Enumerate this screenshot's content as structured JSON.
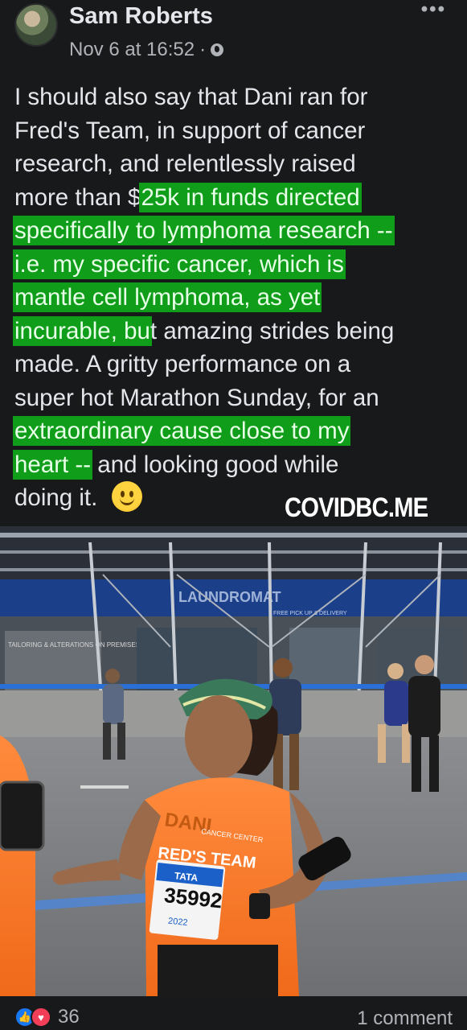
{
  "post": {
    "author": "Sam Roberts",
    "timestamp": "Nov 6 at 16:52",
    "separator": "·",
    "privacy_icon": "globe-icon",
    "more_icon": "more-options-icon",
    "more_glyph": "•••",
    "text_lines": [
      [
        {
          "t": "I should also say that Dani ran for",
          "hl": false
        }
      ],
      [
        {
          "t": "Fred's Team, in support of cancer",
          "hl": false
        }
      ],
      [
        {
          "t": "research, and relentlessly raised",
          "hl": false
        }
      ],
      [
        {
          "t": "more than $",
          "hl": false
        },
        {
          "t": "25k in funds directed",
          "hl": true
        }
      ],
      [
        {
          "t": "specifically to lymphoma research --",
          "hl": true
        }
      ],
      [
        {
          "t": "i.e. my specific cancer, which is",
          "hl": true
        }
      ],
      [
        {
          "t": "mantle cell lymphoma, as yet",
          "hl": true
        }
      ],
      [
        {
          "t": "incurable, bu",
          "hl": true
        },
        {
          "t": "t amazing strides being",
          "hl": false
        }
      ],
      [
        {
          "t": "made.  A gritty performance on a",
          "hl": false
        }
      ],
      [
        {
          "t": "super hot Marathon Sunday, for an",
          "hl": false
        }
      ],
      [
        {
          "t": "extraordinary cause close to my",
          "hl": true
        }
      ],
      [
        {
          "t": "heart --",
          "hl": true
        },
        {
          "t": " and looking good while",
          "hl": false
        }
      ],
      [
        {
          "t": "doing it.",
          "hl": false
        }
      ]
    ],
    "emoji": "slightly-smiling-face-emoji",
    "highlight_color": "#0f9d1a"
  },
  "watermark": "COVIDBC.ME",
  "photo": {
    "storefront_sign": "LAUNDROMAT",
    "shop_sign": "TAILORING & ALTERATIONS ON PREMISES",
    "awning_text": "FREE PICK UP & DELIVERY",
    "shirt_name": "DANI",
    "shirt_team": "RED'S TEAM",
    "shirt_sub": "CANCER CENTER",
    "bib_number": "35992",
    "bib_sponsor": "TATA",
    "bib_year": "2022"
  },
  "footer": {
    "reaction_count": "36",
    "comments_label": "1 comment",
    "like_icon": "like-reaction-icon",
    "love_icon": "love-reaction-icon"
  }
}
